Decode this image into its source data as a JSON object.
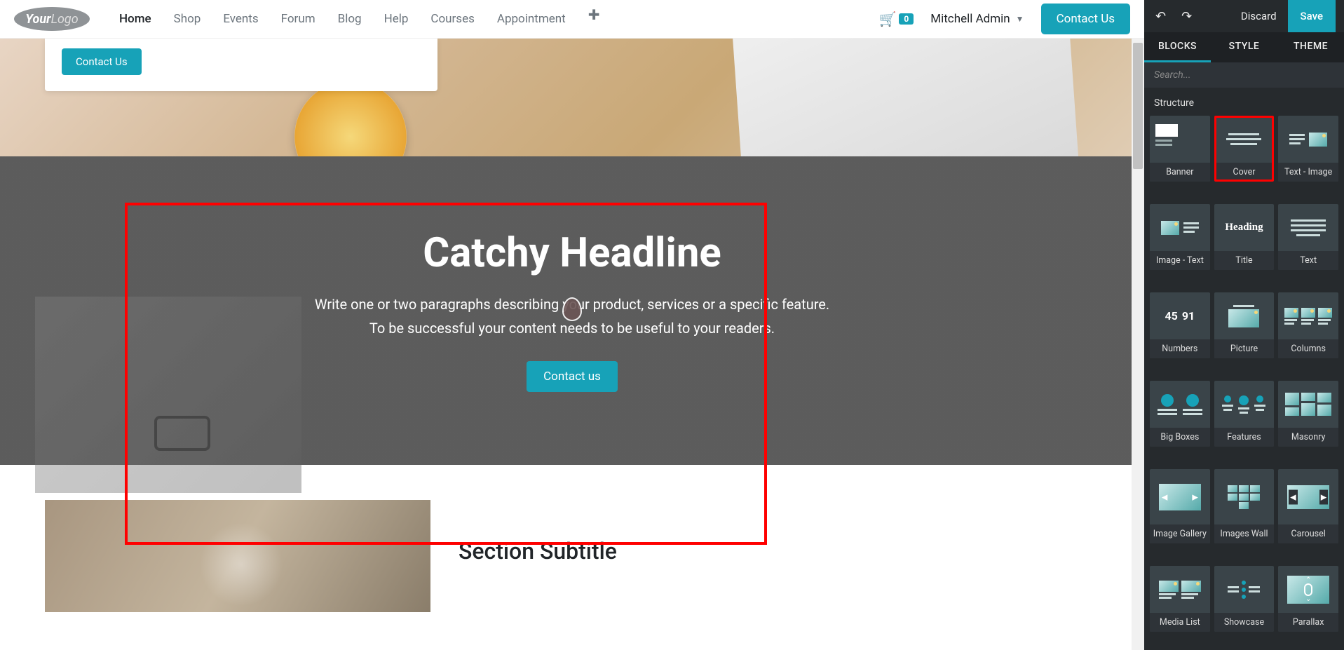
{
  "nav": {
    "logo": {
      "your": "Your",
      "logo": "Logo"
    },
    "links": [
      "Home",
      "Shop",
      "Events",
      "Forum",
      "Blog",
      "Help",
      "Courses",
      "Appointment"
    ],
    "active_index": 0,
    "cart_count": "0",
    "user_name": "Mitchell Admin",
    "contact_label": "Contact Us"
  },
  "hero_card_btn": "Contact Us",
  "cover": {
    "headline": "Catchy Headline",
    "para1": "Write one or two paragraphs describing your product, services or a specific feature.",
    "para2": "To be successful your content needs to be useful to your readers.",
    "cta": "Contact us"
  },
  "subtitle": {
    "heading": "Section Subtitle"
  },
  "sidebar": {
    "discard": "Discard",
    "save": "Save",
    "tabs": [
      "BLOCKS",
      "STYLE",
      "THEME"
    ],
    "active_tab": 0,
    "search_placeholder": "Search...",
    "section_title": "Structure",
    "blocks": [
      "Banner",
      "Cover",
      "Text - Image",
      "Image - Text",
      "Title",
      "Text",
      "Numbers",
      "Picture",
      "Columns",
      "Big Boxes",
      "Features",
      "Masonry",
      "Image Gallery",
      "Images Wall",
      "Carousel",
      "Media List",
      "Showcase",
      "Parallax"
    ],
    "highlighted_block_index": 1
  }
}
